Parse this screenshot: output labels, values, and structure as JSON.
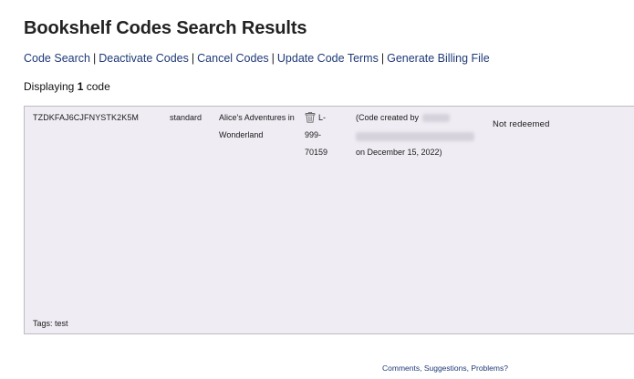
{
  "page": {
    "title": "Bookshelf Codes Search Results"
  },
  "nav": {
    "items": [
      {
        "label": "Code Search"
      },
      {
        "label": "Deactivate Codes"
      },
      {
        "label": "Cancel Codes"
      },
      {
        "label": "Update Code Terms"
      },
      {
        "label": "Generate Billing File"
      }
    ],
    "separator": "|"
  },
  "summary": {
    "prefix": "Displaying",
    "count": "1",
    "suffix": "code"
  },
  "result": {
    "code": "TZDKFAJ6CJFNYSTK2K5M",
    "type": "standard",
    "title": "Alice's Adventures in Wonderland",
    "id_first": "L-",
    "id_rest": "999-70159",
    "created_prefix": "(Code created by",
    "created_date": "on December 15, 2022)",
    "status": "Not redeemed",
    "tags": "Tags: test",
    "delete_icon": "trash-icon"
  },
  "footer": {
    "link_label": "Comments, Suggestions, Problems?"
  }
}
